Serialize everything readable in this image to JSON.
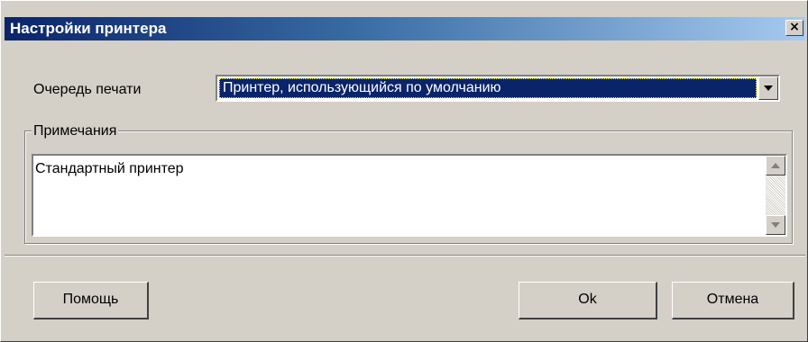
{
  "window": {
    "title": "Настройки принтера",
    "close_label": "×"
  },
  "queue": {
    "label": "Очередь печати",
    "selected": "Принтер, использующийся по умолчанию"
  },
  "notes": {
    "group_label": "Примечания",
    "text": "Стандартный принтер"
  },
  "buttons": {
    "help": "Помощь",
    "ok": "Ok",
    "cancel": "Отмена"
  },
  "colors": {
    "titlebar_start": "#0a246a",
    "titlebar_end": "#a6caf0",
    "face": "#d4d0c8",
    "selection": "#0a246a"
  },
  "icons": {
    "close": "close-icon",
    "dropdown": "chevron-down-icon",
    "scroll_up": "scroll-up-icon",
    "scroll_down": "scroll-down-icon"
  }
}
